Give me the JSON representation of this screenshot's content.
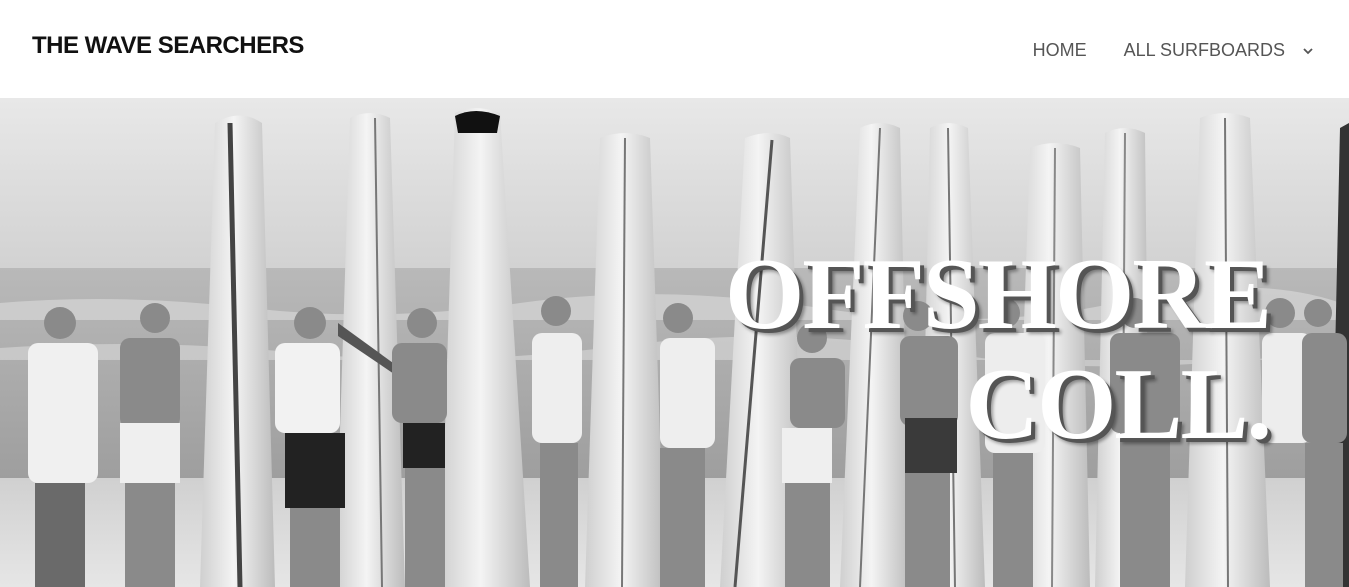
{
  "site": {
    "title": "THE WAVE SEARCHERS"
  },
  "nav": {
    "items": [
      {
        "label": "HOME"
      },
      {
        "label": "ALL SURFBOARDS",
        "icon": "chevron-down-icon"
      }
    ]
  },
  "hero": {
    "title_line1": "OFFSHORE",
    "title_line2": "COLL.",
    "image": "black-and-white photo of surfers standing with longboards on a beach"
  }
}
